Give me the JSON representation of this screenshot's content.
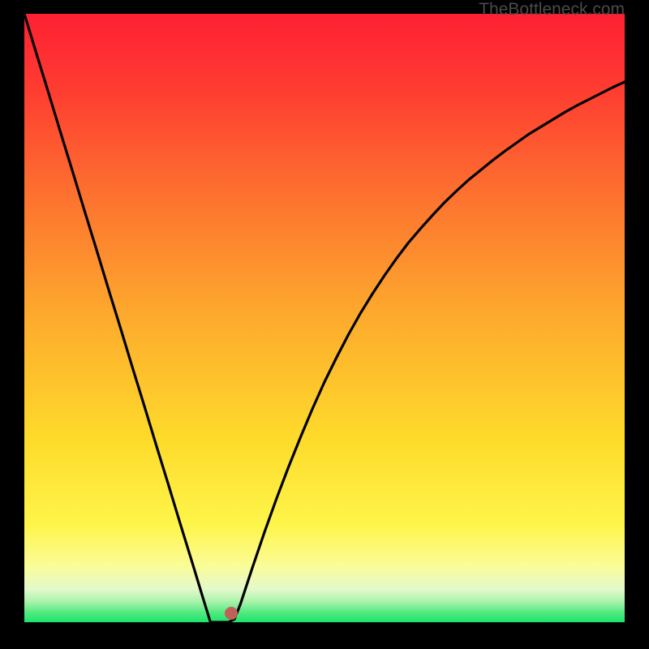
{
  "watermark": "TheBottleneck.com",
  "colors": {
    "top": "#fe2033",
    "mid": "#fedb2b",
    "bottom_band": "#f8fc9f",
    "bottom": "#1ae66c",
    "curve": "#000000",
    "dot": "#c06058",
    "frame": "#000000"
  },
  "chart_data": {
    "type": "line",
    "title": "",
    "xlabel": "",
    "ylabel": "",
    "xlim": [
      0,
      100
    ],
    "ylim": [
      0,
      100
    ],
    "x": [
      0,
      2,
      4,
      6,
      8,
      10,
      12,
      14,
      16,
      18,
      20,
      22,
      24,
      26,
      28,
      30,
      31,
      32,
      33,
      34,
      35,
      36,
      38,
      40,
      42,
      44,
      46,
      48,
      50,
      52,
      54,
      56,
      58,
      60,
      62,
      64,
      66,
      68,
      70,
      72,
      74,
      76,
      78,
      80,
      82,
      84,
      86,
      88,
      90,
      92,
      94,
      96,
      98,
      100
    ],
    "y": [
      100,
      93.5,
      87.1,
      80.6,
      74.2,
      67.7,
      61.3,
      54.8,
      48.4,
      41.9,
      35.5,
      29.0,
      22.6,
      16.1,
      9.7,
      3.2,
      0.0,
      0.0,
      0.0,
      0.0,
      0.5,
      3.0,
      9.0,
      14.8,
      20.3,
      25.5,
      30.4,
      35.1,
      39.5,
      43.5,
      47.3,
      50.8,
      54.0,
      57.0,
      59.8,
      62.4,
      64.7,
      66.9,
      69.0,
      70.9,
      72.7,
      74.3,
      75.9,
      77.4,
      78.8,
      80.2,
      81.4,
      82.6,
      83.8,
      84.9,
      85.9,
      86.9,
      87.9,
      88.8
    ],
    "minimum_x": 33,
    "minimum_y": 0,
    "dot": {
      "x": 34.5,
      "y": 1.5
    }
  }
}
